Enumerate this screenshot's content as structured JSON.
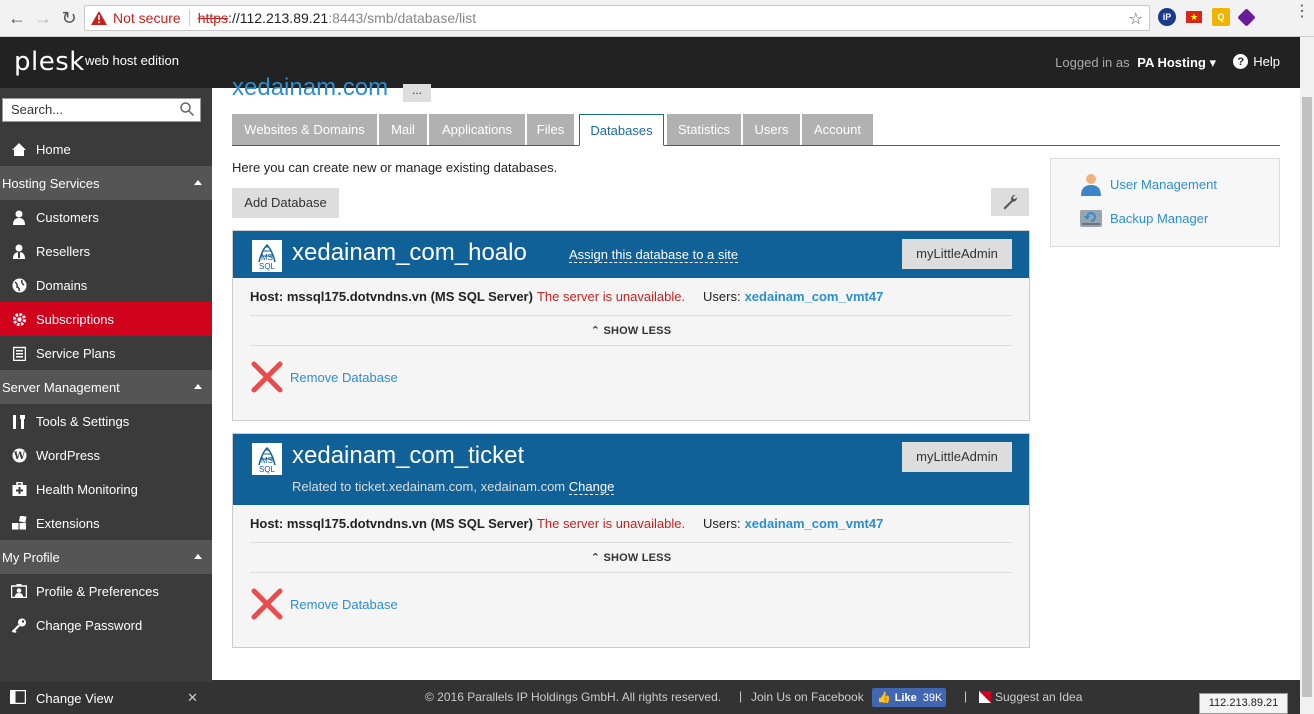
{
  "browser": {
    "security_label": "Not secure",
    "url_proto": "https",
    "url_host": "://112.213.89.21",
    "url_rest": ":8443/smb/database/list"
  },
  "header": {
    "logo": "plesk",
    "edition": "web host edition",
    "logged_in_label": "Logged in as",
    "user": "PA Hosting",
    "help": "Help"
  },
  "sidebar": {
    "search_placeholder": "Search...",
    "home": "Home",
    "group_hosting": "Hosting Services",
    "customers": "Customers",
    "resellers": "Resellers",
    "domains": "Domains",
    "subscriptions": "Subscriptions",
    "service_plans": "Service Plans",
    "group_server": "Server Management",
    "tools": "Tools & Settings",
    "wordpress": "WordPress",
    "health": "Health Monitoring",
    "extensions": "Extensions",
    "group_profile": "My Profile",
    "profile": "Profile & Preferences",
    "change_password": "Change Password",
    "change_view": "Change View"
  },
  "main": {
    "domain_title": "xedainam.com",
    "dots": "...",
    "tabs": [
      "Websites & Domains",
      "Mail",
      "Applications",
      "Files",
      "Databases",
      "Statistics",
      "Users",
      "Account"
    ],
    "intro": "Here you can create new or manage existing databases.",
    "add_database": "Add Database",
    "databases": [
      {
        "name": "xedainam_com_hoalo",
        "assign": "Assign this database to a site",
        "mla": "myLittleAdmin",
        "host": "Host: mssql175.dotvndns.vn (MS SQL Server)",
        "error": "The server is unavailable.",
        "users_label": "Users:",
        "users": "xedainam_com_vmt47",
        "show_less": "SHOW LESS",
        "remove": "Remove Database"
      },
      {
        "name": "xedainam_com_ticket",
        "related": "Related to ticket.xedainam.com, xedainam.com",
        "change": "Change",
        "mla": "myLittleAdmin",
        "host": "Host: mssql175.dotvndns.vn (MS SQL Server)",
        "error": "The server is unavailable.",
        "users_label": "Users:",
        "users": "xedainam_com_vmt47",
        "show_less": "SHOW LESS",
        "remove": "Remove Database"
      }
    ],
    "mssql_label": "MS SQL"
  },
  "right_panel": {
    "user_management": "User Management",
    "backup_manager": "Backup Manager"
  },
  "footer": {
    "copyright": "© 2016 Parallels IP Holdings GmbH. All rights reserved.",
    "join": "Join Us on Facebook",
    "like": "Like",
    "like_count": "39K",
    "suggest": "Suggest an Idea",
    "ip_tooltip": "112.213.89.21"
  }
}
